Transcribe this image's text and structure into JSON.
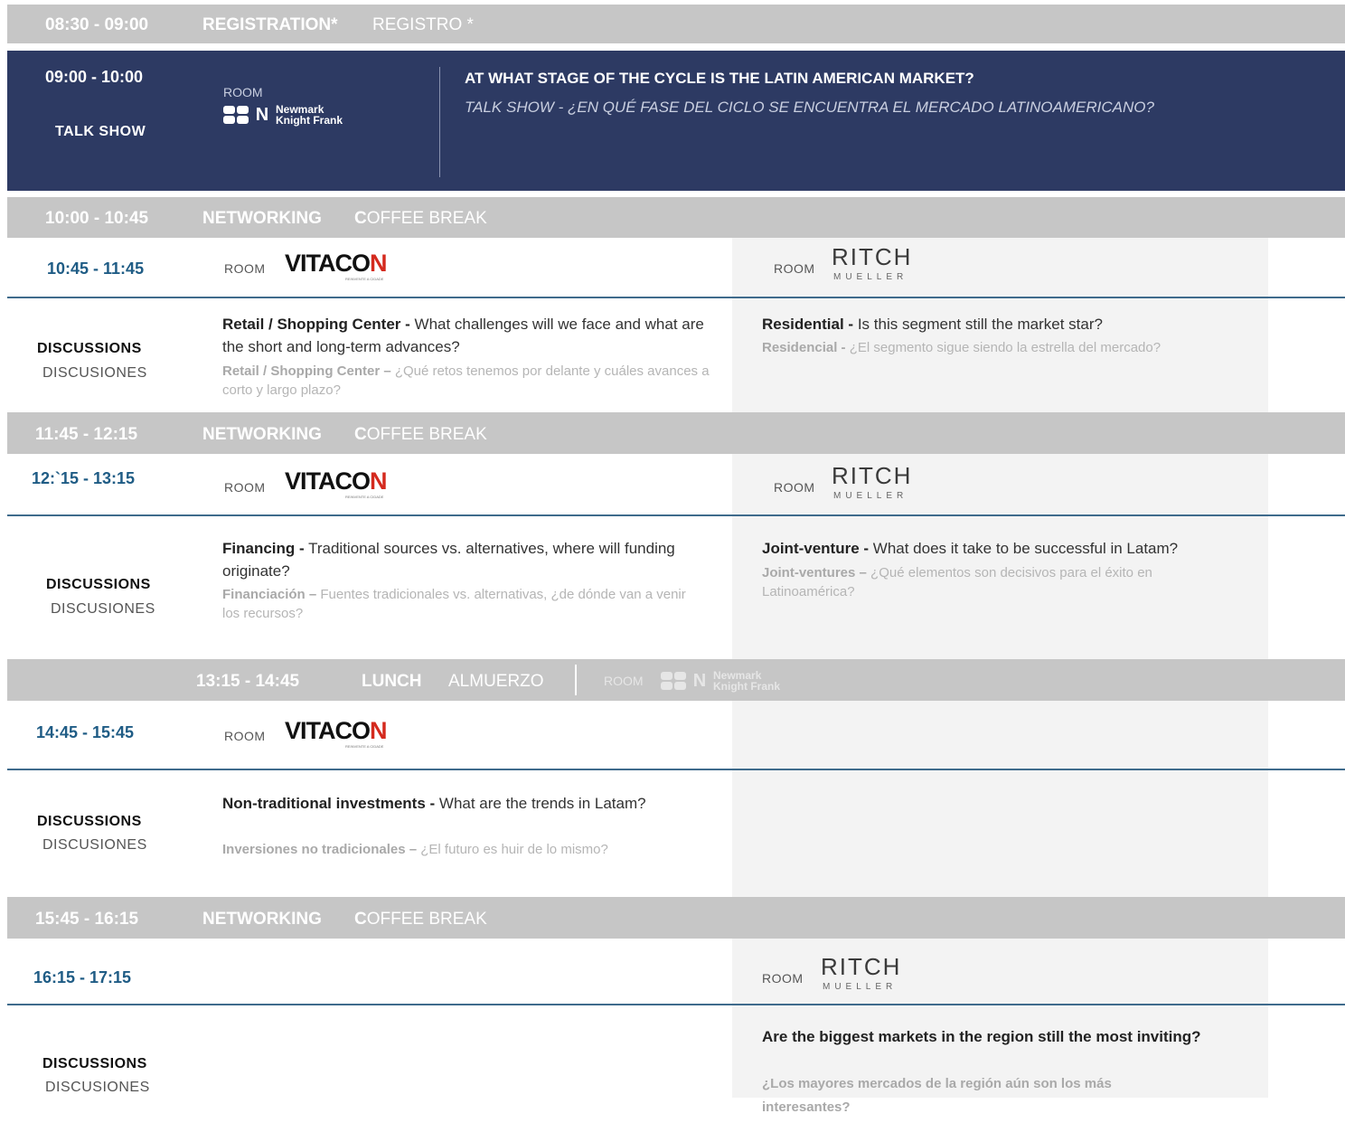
{
  "registration": {
    "time": "08:30 - 09:00",
    "label_en": "REGISTRATION*",
    "label_es": "REGISTRO *"
  },
  "talkshow": {
    "time": "09:00 - 10:00",
    "type": "TALK SHOW",
    "room": "ROOM",
    "sponsor_line1": "Newmark",
    "sponsor_line2": "Knight Frank",
    "title_en": "AT WHAT STAGE OF THE CYCLE IS THE LATIN AMERICAN MARKET?",
    "title_es": "TALK SHOW - ¿EN QUÉ FASE DEL CICLO SE ENCUENTRA EL MERCADO LATINOAMERICANO?"
  },
  "break1": {
    "time": "10:00 - 10:45",
    "label_en": "NETWORKING",
    "label_c": "C",
    "label_rest": "OFFEE BREAK"
  },
  "session1": {
    "time": "10:45 - 11:45",
    "room": "ROOM",
    "left_sponsor": {
      "main": "VITACO",
      "accent": "N",
      "sub": "REINVENTE A CIDADE"
    },
    "right_sponsor": {
      "main": "RITCH",
      "sub": "MUELLER"
    },
    "disc_en": "DISCUSSIONS",
    "disc_es": "DISCUSIONES",
    "left_topic": {
      "title_bold": "Retail / Shopping Center -",
      "title_rest": " What challenges will we face and what are the short and long-term advances?",
      "es_bold": "Retail / Shopping Center –",
      "es_rest": " ¿Qué retos tenemos por delante y cuáles avances a corto y largo plazo?"
    },
    "right_topic": {
      "title_bold": "Residential -",
      "title_rest": " Is this segment still the market star?",
      "es_bold": "Residencial -",
      "es_rest": " ¿El segmento sigue siendo la estrella del mercado?"
    }
  },
  "break2": {
    "time": "11:45 - 12:15",
    "label_en": "NETWORKING",
    "label_c": "C",
    "label_rest": "OFFEE BREAK"
  },
  "session2": {
    "time": "12:`15 - 13:15",
    "room": "ROOM",
    "disc_en": "DISCUSSIONS",
    "disc_es": "DISCUSIONES",
    "left_topic": {
      "title_bold": "Financing -",
      "title_rest": " Traditional sources vs. alternatives, where will funding originate?",
      "es_bold": "Financiación –",
      "es_rest": " Fuentes tradicionales vs. alternativas, ¿de dónde van a venir los recursos?"
    },
    "right_topic": {
      "title_bold": "Joint-venture -",
      "title_rest": " What does it take to be successful in Latam?",
      "es_bold": "Joint-ventures –",
      "es_rest": " ¿Qué elementos son decisivos para el éxito en Latinoamérica?"
    }
  },
  "lunch": {
    "time": "13:15 - 14:45",
    "label_en": "LUNCH",
    "label_es": "ALMUERZO",
    "room": "ROOM"
  },
  "session3": {
    "time": "14:45 - 15:45",
    "room": "ROOM",
    "disc_en": "DISCUSSIONS",
    "disc_es": "DISCUSIONES",
    "left_topic": {
      "title_bold": "Non-traditional investments -",
      "title_rest": " What are the trends in Latam?",
      "es_bold": "Inversiones no tradicionales –",
      "es_rest": " ¿El futuro es huir de lo mismo?"
    }
  },
  "break3": {
    "time": "15:45 - 16:15",
    "label_en": "NETWORKING",
    "label_c": "C",
    "label_rest": "OFFEE BREAK"
  },
  "session4": {
    "time": "16:15 - 17:15",
    "room": "ROOM",
    "disc_en": "DISCUSSIONS",
    "disc_es": "DISCUSIONES",
    "right_topic": {
      "title": "Are the biggest markets in the region still the most inviting?",
      "es": "¿Los mayores mercados de la región aún son los más interesantes?"
    }
  },
  "colors": {
    "navy": "#2d3a63",
    "gray_bar": "#c6c6c6",
    "accent_blue": "#1f5c85",
    "vitacon_red": "#d42a1e"
  }
}
